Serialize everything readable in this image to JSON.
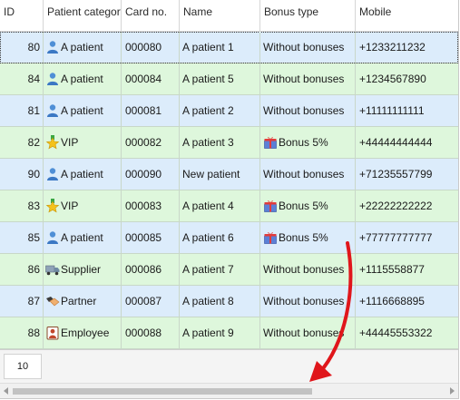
{
  "columns": {
    "id": "ID",
    "category": "Patient category",
    "card": "Card no.",
    "name": "Name",
    "bonus": "Bonus type",
    "mobile": "Mobile"
  },
  "rows": [
    {
      "id": "80",
      "category": "A patient",
      "cat_icon": "person-icon",
      "card": "000080",
      "name": "A patient 1",
      "bonus": "Without bonuses",
      "bonus_icon": "",
      "mobile": "+1233211232",
      "tint": "blue",
      "selected": true
    },
    {
      "id": "84",
      "category": "A patient",
      "cat_icon": "person-icon",
      "card": "000084",
      "name": "A patient 5",
      "bonus": "Without bonuses",
      "bonus_icon": "",
      "mobile": "+1234567890",
      "tint": "green",
      "selected": false
    },
    {
      "id": "81",
      "category": "A patient",
      "cat_icon": "person-icon",
      "card": "000081",
      "name": "A patient 2",
      "bonus": "Without bonuses",
      "bonus_icon": "",
      "mobile": "+11111111111",
      "tint": "blue",
      "selected": false
    },
    {
      "id": "82",
      "category": "VIP",
      "cat_icon": "star-icon",
      "card": "000082",
      "name": "A patient 3",
      "bonus": "Bonus 5%",
      "bonus_icon": "gift-icon",
      "mobile": "+44444444444",
      "tint": "green",
      "selected": false
    },
    {
      "id": "90",
      "category": "A patient",
      "cat_icon": "person-icon",
      "card": "000090",
      "name": "New patient",
      "bonus": "Without bonuses",
      "bonus_icon": "",
      "mobile": "+71235557799",
      "tint": "blue",
      "selected": false
    },
    {
      "id": "83",
      "category": "VIP",
      "cat_icon": "star-icon",
      "card": "000083",
      "name": "A patient 4",
      "bonus": "Bonus 5%",
      "bonus_icon": "gift-icon",
      "mobile": "+22222222222",
      "tint": "green",
      "selected": false
    },
    {
      "id": "85",
      "category": "A patient",
      "cat_icon": "person-icon",
      "card": "000085",
      "name": "A patient 6",
      "bonus": "Bonus 5%",
      "bonus_icon": "gift-icon",
      "mobile": "+77777777777",
      "tint": "blue",
      "selected": false
    },
    {
      "id": "86",
      "category": "Supplier",
      "cat_icon": "truck-icon",
      "card": "000086",
      "name": "A patient 7",
      "bonus": "Without bonuses",
      "bonus_icon": "",
      "mobile": "+1115558877",
      "tint": "green",
      "selected": false
    },
    {
      "id": "87",
      "category": "Partner",
      "cat_icon": "handshake-icon",
      "card": "000087",
      "name": "A patient 8",
      "bonus": "Without bonuses",
      "bonus_icon": "",
      "mobile": "+1116668895",
      "tint": "blue",
      "selected": false
    },
    {
      "id": "88",
      "category": "Employee",
      "cat_icon": "employee-icon",
      "card": "000088",
      "name": "A patient 9",
      "bonus": "Without bonuses",
      "bonus_icon": "",
      "mobile": "+44445553322",
      "tint": "green",
      "selected": false
    }
  ],
  "footer": {
    "count": "10"
  },
  "colors": {
    "row_blue": "#dcecfb",
    "row_green": "#def7dc",
    "annotation_arrow": "#e0161b"
  }
}
